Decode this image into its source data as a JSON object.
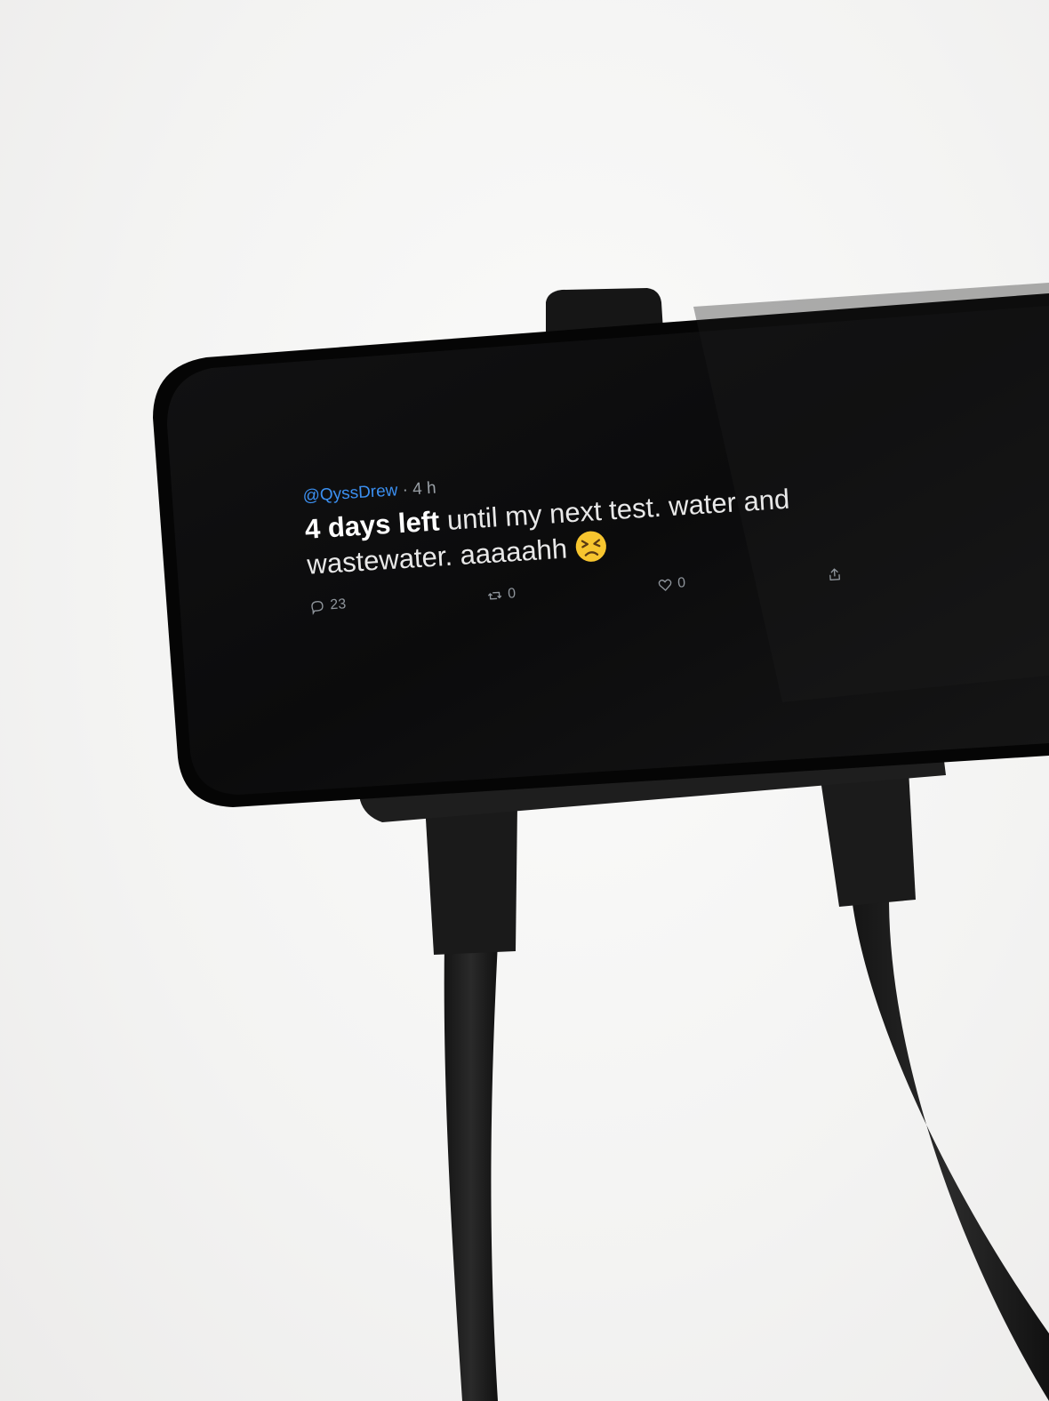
{
  "tweet": {
    "handle": "@QyssDrew",
    "separator": " · ",
    "time": "4 h",
    "text_bold": "4 days left",
    "text_rest": " until my next test. water and wastewater. aaaaahh",
    "emoji_icon": "persevering-face-emoji"
  },
  "actions": {
    "reply_count": "23",
    "retweet_count": "0",
    "like_count": "0",
    "reply_icon": "comment-icon",
    "retweet_icon": "retweet-icon",
    "like_icon": "heart-icon",
    "share_icon": "share-icon"
  },
  "colors": {
    "background": "#f6f6f5",
    "screen": "#0d0d0e",
    "handle": "#3b8ff0",
    "text": "#e8e8e8"
  }
}
